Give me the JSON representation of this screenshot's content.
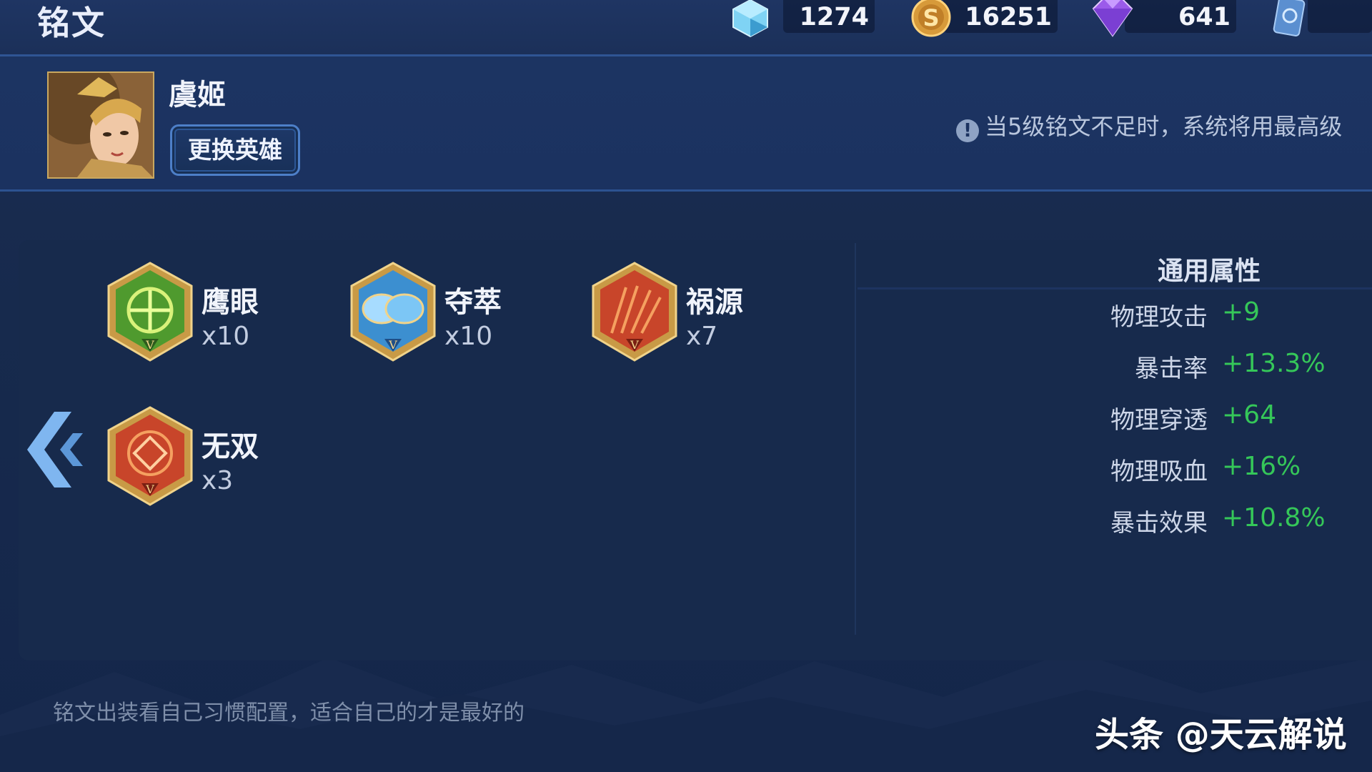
{
  "header": {
    "title": "铭文",
    "currencies": [
      {
        "icon": "diamond-crystal-icon",
        "value": "1274"
      },
      {
        "icon": "gold-coin-icon",
        "value": "16251"
      },
      {
        "icon": "purple-gem-icon",
        "value": "641"
      },
      {
        "icon": "ticket-card-icon",
        "value": ""
      }
    ]
  },
  "hero": {
    "name": "虞姬",
    "change_button": "更换英雄",
    "notice": "当5级铭文不足时，系统将用最高级"
  },
  "runes": [
    {
      "name": "鹰眼",
      "count": "x10",
      "color": "#4f9a2e",
      "icon": "green-rune-icon"
    },
    {
      "name": "夺萃",
      "count": "x10",
      "color": "#3c8fd0",
      "icon": "blue-rune-icon"
    },
    {
      "name": "祸源",
      "count": "x7",
      "color": "#c8452a",
      "icon": "red-rune-icon"
    },
    {
      "name": "无双",
      "count": "x3",
      "color": "#c8452a",
      "icon": "red-rune-icon"
    }
  ],
  "attributes": {
    "title": "通用属性",
    "items": [
      {
        "label": "物理攻击",
        "value": "+9"
      },
      {
        "label": "暴击率",
        "value": "+13.3%"
      },
      {
        "label": "物理穿透",
        "value": "+64"
      },
      {
        "label": "物理吸血",
        "value": "+16%"
      },
      {
        "label": "暴击效果",
        "value": "+10.8%"
      }
    ]
  },
  "tip": "铭文出装看自己习惯配置，适合自己的才是最好的",
  "watermark": "头条 @天云解说"
}
